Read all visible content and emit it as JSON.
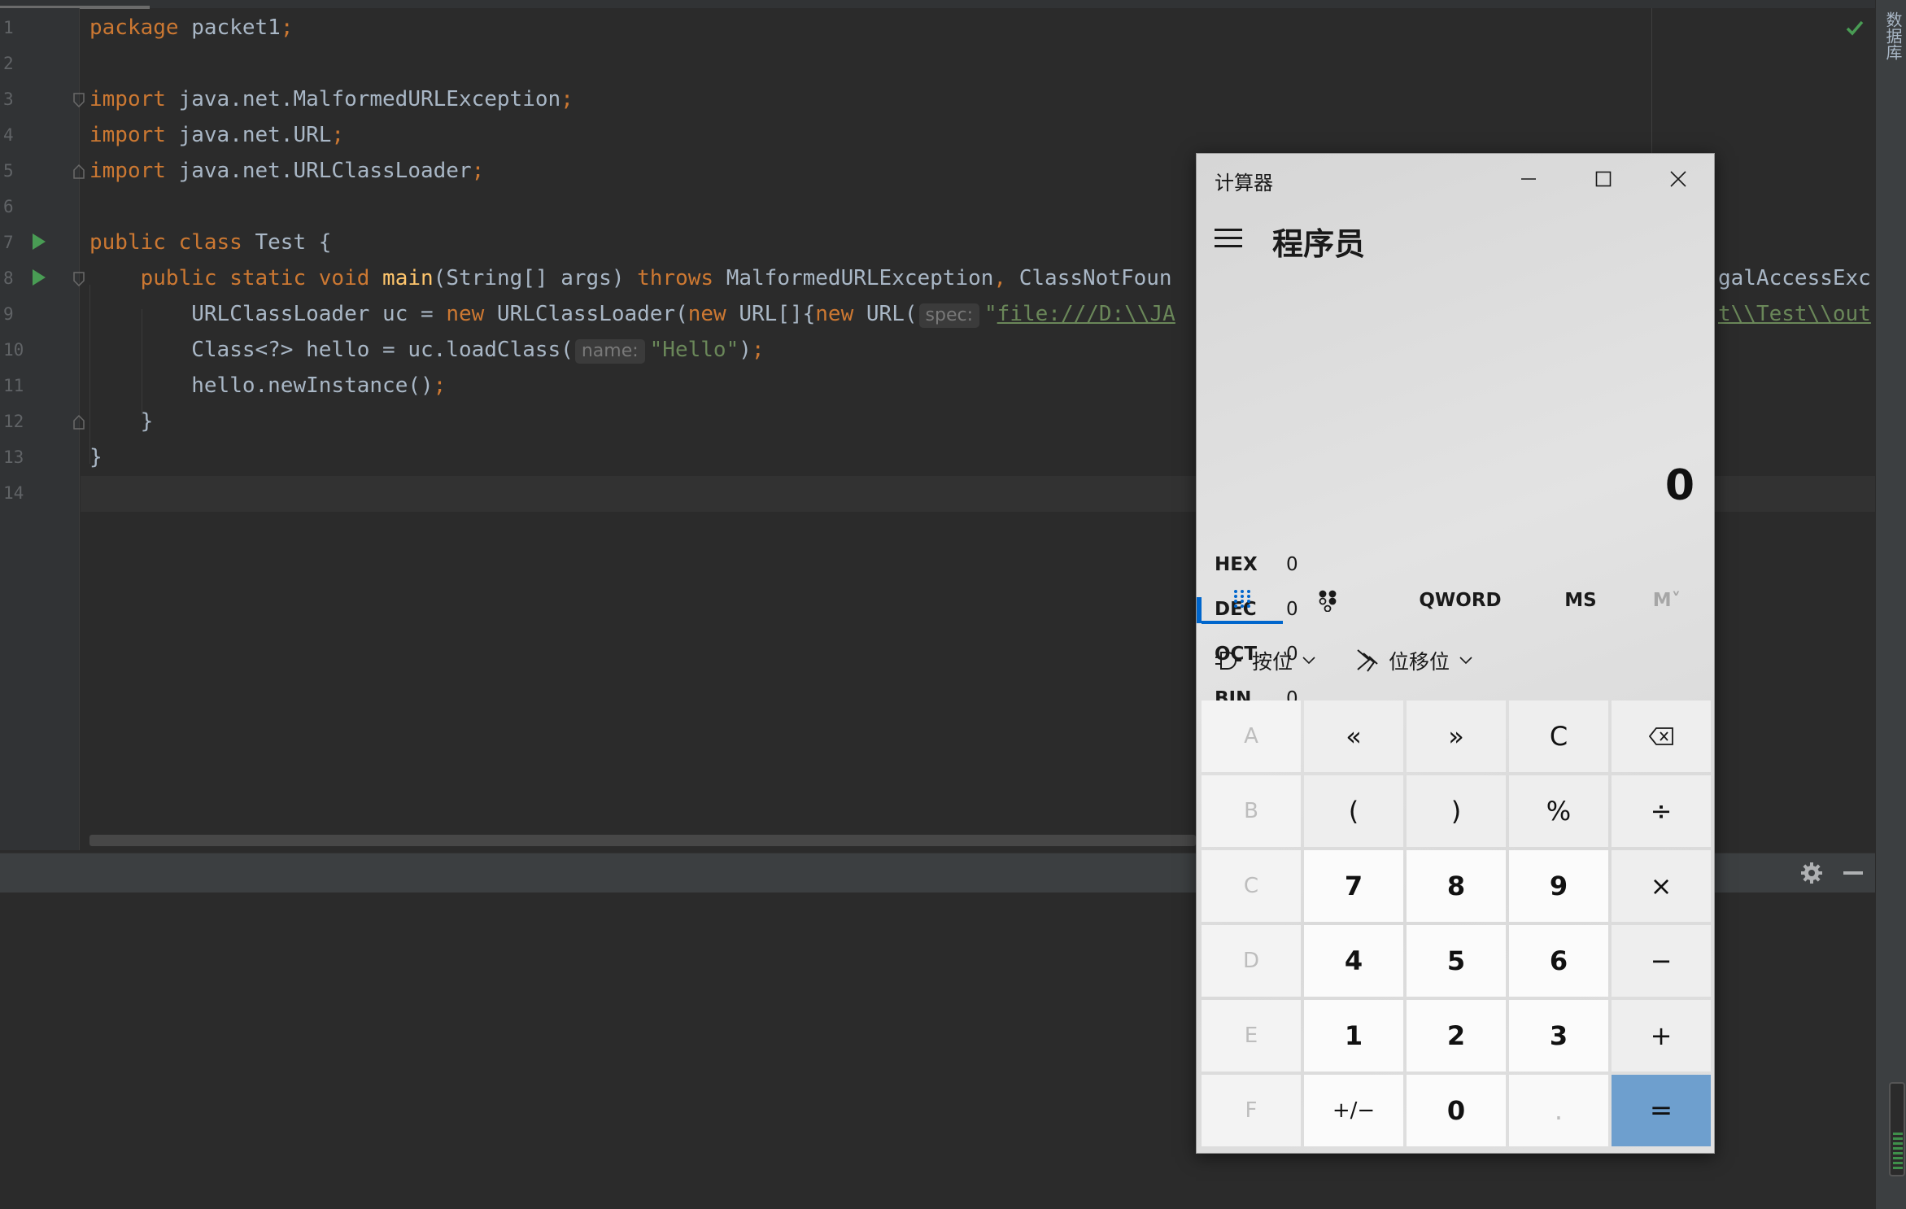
{
  "editor": {
    "line_numbers": [
      "1",
      "2",
      "3",
      "4",
      "5",
      "6",
      "7",
      "8",
      "9",
      "10",
      "11",
      "12",
      "13",
      "14"
    ],
    "lines": {
      "l1": {
        "kw_package": "package",
        "text": " packet1",
        "semi": ";"
      },
      "l3": {
        "kw": "import",
        "text": " java.net.MalformedURLException",
        "semi": ";"
      },
      "l4": {
        "kw": "import",
        "text": " java.net.URL",
        "semi": ";"
      },
      "l5": {
        "kw": "import",
        "text": " java.net.URLClassLoader",
        "semi": ";"
      },
      "l7": {
        "kw": "public class",
        "text": " Test {"
      },
      "l8": {
        "indent": "    ",
        "kw1": "public static void",
        "sp": " ",
        "fn": "main",
        "text1": "(String[] args) ",
        "kw2": "throws",
        "text2": " MalformedURLException",
        "comma": ",",
        "text3": " ClassNotFoun",
        "tail": "galAccessExc"
      },
      "l9": {
        "indent": "        ",
        "text1": "URLClassLoader uc = ",
        "kw1": "new",
        "text2": " URLClassLoader(",
        "kw2": "new",
        "text3": " URL[]{",
        "kw3": "new",
        "text4": " URL(",
        "hint": "spec:",
        "quote": "\"",
        "url": "file:///D:\\\\JA",
        "tail_url": "t\\\\Test\\\\out"
      },
      "l10": {
        "indent": "        ",
        "text1": "Class<?> hello = uc.loadClass(",
        "hint": "name:",
        "str": "\"Hello\"",
        "text2": ")",
        "semi": ";"
      },
      "l11": {
        "indent": "        ",
        "text1": "hello.newInstance()",
        "semi": ";"
      },
      "l12": {
        "indent": "    ",
        "text": "}"
      },
      "l13": {
        "text": "}"
      }
    }
  },
  "side_panel": {
    "label": "数据库"
  },
  "calculator": {
    "window_title": "计算器",
    "mode_title": "程序员",
    "display": "0",
    "radix": [
      {
        "name": "HEX",
        "value": "0",
        "active": false
      },
      {
        "name": "DEC",
        "value": "0",
        "active": true
      },
      {
        "name": "OCT",
        "value": "0",
        "active": false
      },
      {
        "name": "BIN",
        "value": "0",
        "active": false
      }
    ],
    "tabs": {
      "word_size": "QWORD",
      "ms": "MS",
      "mc": "M˅"
    },
    "bitops": {
      "bitwise": "按位",
      "bitshift": "位移位"
    },
    "keys": {
      "A": "A",
      "lsh": "«",
      "rsh": "»",
      "C": "C",
      "B": "B",
      "lparen": "(",
      "rparen": ")",
      "mod": "%",
      "div": "÷",
      "Chex": "C",
      "n7": "7",
      "n8": "8",
      "n9": "9",
      "mul": "×",
      "D": "D",
      "n4": "4",
      "n5": "5",
      "n6": "6",
      "sub": "−",
      "E": "E",
      "n1": "1",
      "n2": "2",
      "n3": "3",
      "add": "+",
      "F": "F",
      "neg": "+/−",
      "n0": "0",
      "dot": ".",
      "eq": "="
    },
    "colors": {
      "accent": "#0066cc",
      "equals": "#6e9fce"
    }
  }
}
